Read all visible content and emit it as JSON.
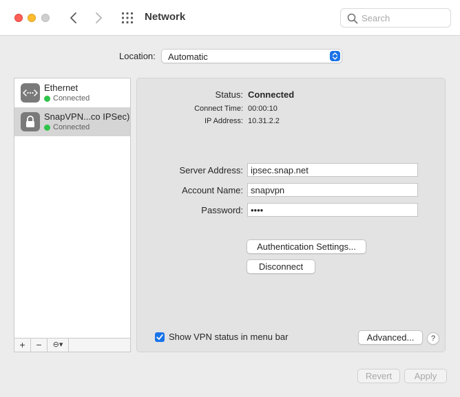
{
  "window": {
    "title": "Network",
    "search_placeholder": "Search"
  },
  "location": {
    "label": "Location:",
    "value": "Automatic"
  },
  "sidebar": {
    "services": [
      {
        "name": "Ethernet",
        "status": "Connected",
        "icon": "ethernet-icon",
        "selected": false
      },
      {
        "name": "SnapVPN...co IPSec)",
        "status": "Connected",
        "icon": "lock-icon",
        "selected": true
      }
    ],
    "tools": {
      "add": "+",
      "remove": "−",
      "action": "⊖▾"
    }
  },
  "detail": {
    "status_label": "Status:",
    "status_value": "Connected",
    "connect_time_label": "Connect Time:",
    "connect_time_value": "00:00:10",
    "ip_label": "IP Address:",
    "ip_value": "10.31.2.2",
    "server_label": "Server Address:",
    "server_value": "ipsec.snap.net",
    "account_label": "Account Name:",
    "account_value": "snapvpn",
    "password_label": "Password:",
    "password_value": "••••",
    "auth_button": "Authentication Settings...",
    "disconnect_button": "Disconnect",
    "show_vpn_label": "Show VPN status in menu bar",
    "show_vpn_checked": true,
    "advanced_button": "Advanced...",
    "help_button": "?"
  },
  "footer": {
    "revert": "Revert",
    "apply": "Apply"
  },
  "colors": {
    "accent": "#1a73e8",
    "connected": "#30c34b",
    "close": "#fe5f57",
    "minimize": "#febc2e"
  }
}
